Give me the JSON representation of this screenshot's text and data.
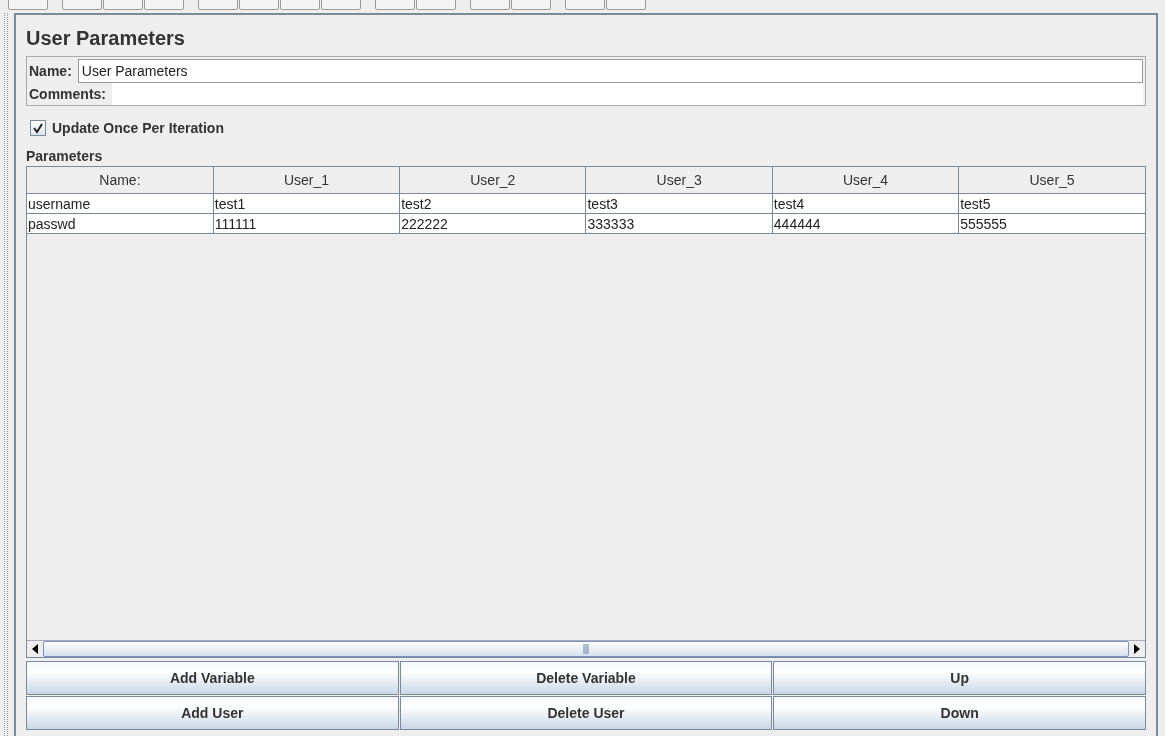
{
  "title": "User Parameters",
  "name_field": {
    "label": "Name:",
    "value": "User Parameters"
  },
  "comments_field": {
    "label": "Comments:"
  },
  "update_once": {
    "label": "Update Once Per Iteration",
    "checked": true
  },
  "parameters": {
    "label": "Parameters",
    "columns": [
      "Name:",
      "User_1",
      "User_2",
      "User_3",
      "User_4",
      "User_5"
    ],
    "rows": [
      [
        "username",
        "test1",
        "test2",
        "test3",
        "test4",
        "test5"
      ],
      [
        "passwd",
        "111111",
        "222222",
        "333333",
        "444444",
        "555555"
      ]
    ]
  },
  "buttons": [
    [
      "Add Variable",
      "Delete Variable",
      "Up"
    ],
    [
      "Add User",
      "Delete User",
      "Down"
    ]
  ]
}
